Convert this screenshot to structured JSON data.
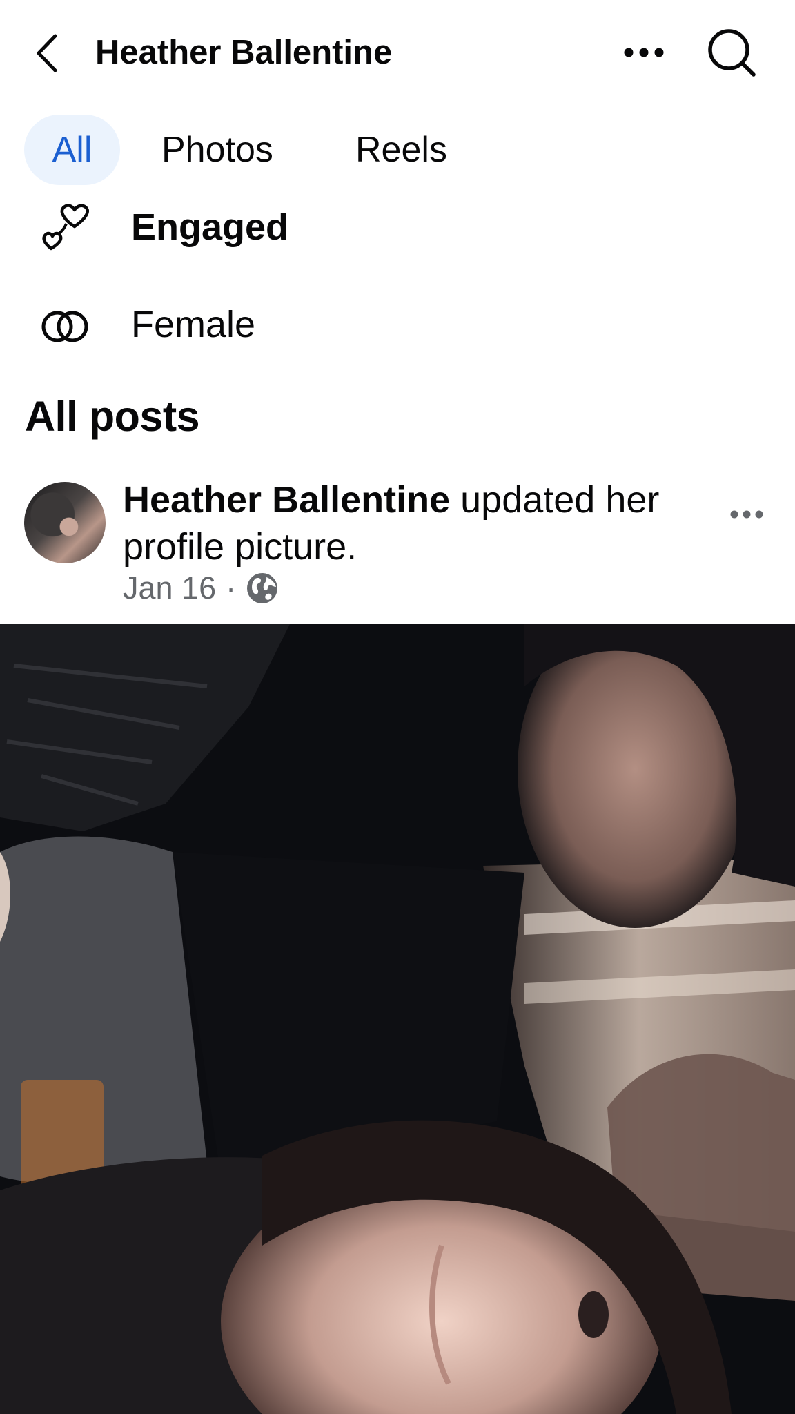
{
  "header": {
    "title": "Heather Ballentine"
  },
  "tabs": [
    {
      "label": "All",
      "selected": true
    },
    {
      "label": "Photos",
      "selected": false
    },
    {
      "label": "Reels",
      "selected": false
    }
  ],
  "details": {
    "relationship": "Engaged",
    "gender": "Female"
  },
  "section": {
    "title": "All posts"
  },
  "post": {
    "author": "Heather Ballentine",
    "action": " updated her profile picture.",
    "date": "Jan 16",
    "separator": "·",
    "audience_icon": "globe-icon"
  },
  "colors": {
    "accent": "#1b5fd1",
    "selected_tab_bg": "#ebf3fd",
    "meta_text": "#65686c"
  }
}
